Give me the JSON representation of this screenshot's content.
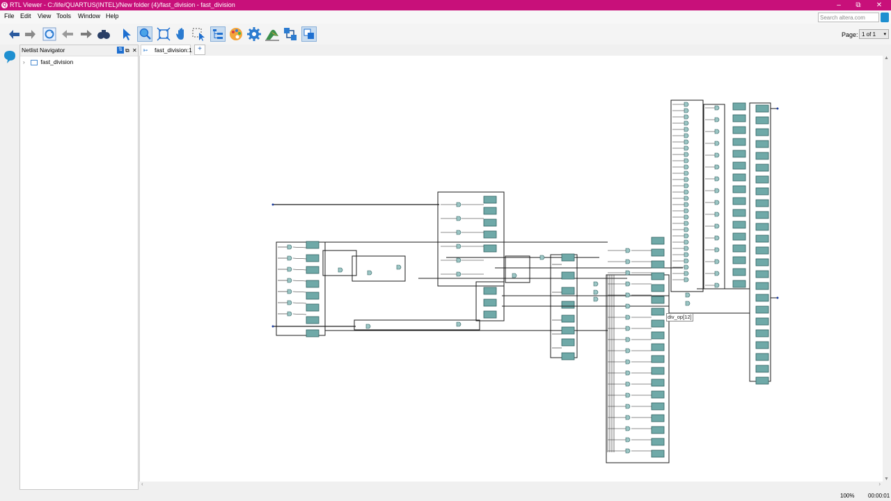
{
  "window": {
    "title": "RTL Viewer - C:/life/QUARTUS(INTEL)/New folder (4)/fast_division - fast_division",
    "app_icon": "quartus-logo-icon",
    "titlebar_color": "#c8107a"
  },
  "menu": {
    "items": [
      "File",
      "Edit",
      "View",
      "Tools",
      "Window",
      "Help"
    ]
  },
  "search": {
    "placeholder": "Search altera.com"
  },
  "toolbar": {
    "icons": [
      "back-icon",
      "forward-icon",
      "refresh-icon",
      "previous-icon",
      "next-icon",
      "find-icon",
      "select-icon",
      "zoom-icon",
      "fit-window-icon",
      "hand-icon",
      "area-select-icon",
      "hierarchy-icon",
      "color-icon",
      "settings-icon",
      "bird-icon",
      "netlist-icon",
      "page-toggle-icon"
    ]
  },
  "page": {
    "label": "Page:",
    "value": "1 of 1"
  },
  "navigator": {
    "title": "Netlist Navigator",
    "root_item": "fast_division"
  },
  "tabs": [
    {
      "label": "fast_division:1"
    }
  ],
  "canvas": {
    "tooltip": "div_op[12]",
    "block_color": "#6fa9a8",
    "wire_color": "#1a1a1a"
  },
  "status": {
    "zoom": "100%",
    "time": "00:00:01"
  }
}
